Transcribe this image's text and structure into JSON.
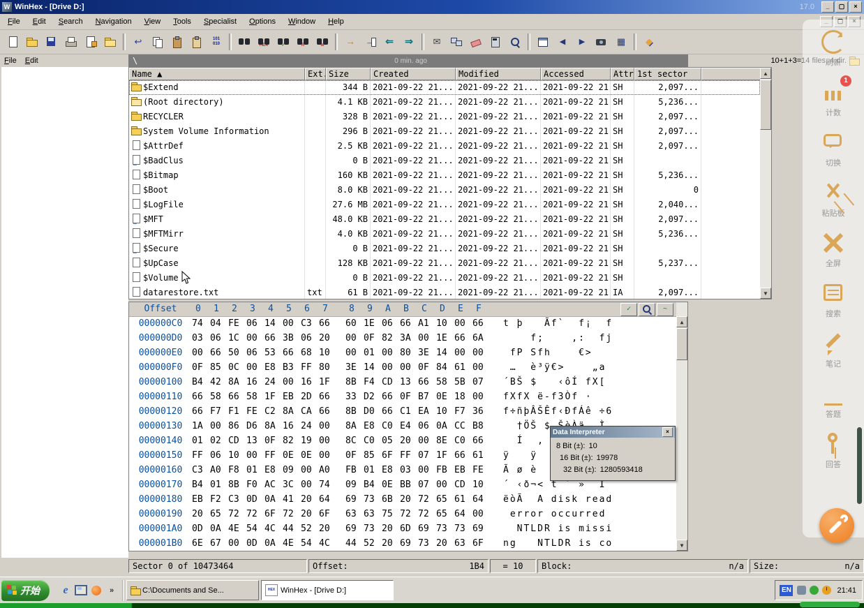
{
  "window": {
    "title": "WinHex - [Drive D:]",
    "version": "17.0",
    "controls": {
      "minimize": "_",
      "maximize": "▢",
      "close": "×"
    }
  },
  "menu": {
    "items": [
      "File",
      "Edit",
      "Search",
      "Navigation",
      "View",
      "Tools",
      "Specialist",
      "Options",
      "Window",
      "Help"
    ]
  },
  "toolbar": {
    "items": [
      {
        "name": "new-file",
        "icon": "page"
      },
      {
        "name": "open-file",
        "icon": "folder"
      },
      {
        "name": "save",
        "icon": "disk"
      },
      {
        "name": "print",
        "icon": "printer"
      },
      {
        "name": "file-properties",
        "icon": "pagepen"
      },
      {
        "name": "open-folder",
        "icon": "folder2"
      },
      {
        "sep": true
      },
      {
        "name": "undo",
        "icon": "undo",
        "glyph": "↩"
      },
      {
        "name": "copy",
        "icon": "copy"
      },
      {
        "name": "clipboard-paste",
        "icon": "clip"
      },
      {
        "name": "clipboard-write",
        "icon": "clip2"
      },
      {
        "name": "convert",
        "icon": "conv",
        "glyph": "101 010"
      },
      {
        "sep": true
      },
      {
        "name": "find-text",
        "icon": "binoc"
      },
      {
        "name": "find-hex",
        "icon": "binochex",
        "glyph": "HEX"
      },
      {
        "name": "find-next",
        "icon": "binoccheck",
        "glyph": "✓"
      },
      {
        "name": "replace",
        "icon": "binocr",
        "glyph": "R"
      },
      {
        "name": "find-again",
        "icon": "binocm",
        "glyph": "M"
      },
      {
        "sep": true
      },
      {
        "name": "goto-offset",
        "icon": "goright",
        "glyph": "→"
      },
      {
        "name": "goto-page",
        "icon": "gopage",
        "glyph": "→"
      },
      {
        "name": "go-back",
        "icon": "backarrow",
        "glyph": "⇐"
      },
      {
        "name": "go-forward",
        "icon": "fwdarrow",
        "glyph": "⇒"
      },
      {
        "sep": true
      },
      {
        "name": "send-mail",
        "icon": "mail",
        "glyph": "✉"
      },
      {
        "name": "network",
        "icon": "net"
      },
      {
        "name": "wipe",
        "icon": "wipe"
      },
      {
        "name": "calculator",
        "icon": "calc"
      },
      {
        "name": "analyze",
        "icon": "mag"
      },
      {
        "sep": true
      },
      {
        "name": "data-interpreter",
        "icon": "interp"
      },
      {
        "name": "previous-window",
        "icon": "prev",
        "glyph": "◀"
      },
      {
        "name": "next-window",
        "icon": "next",
        "glyph": "▶"
      },
      {
        "name": "screenshot",
        "icon": "cam"
      },
      {
        "name": "grid-view",
        "icon": "table",
        "glyph": "▦"
      },
      {
        "sep": true
      },
      {
        "name": "help",
        "icon": "help",
        "glyph": "◆"
      }
    ]
  },
  "left_panel": {
    "items": [
      "File",
      "Edit"
    ]
  },
  "path_bar": {
    "path": "\\",
    "age": "0 min. ago",
    "summary": "10+1+3=14 files, 4 dir."
  },
  "directory": {
    "columns": [
      "Name",
      "Ext.",
      "Size",
      "Created",
      "Modified",
      "Accessed",
      "Attr.",
      "1st sector"
    ],
    "sort_indicator": "▲",
    "rows": [
      {
        "icon": "folder",
        "name": "$Extend",
        "ext": "",
        "size": "344 B",
        "created": "2021-09-22 21...",
        "modified": "2021-09-22 21...",
        "accessed": "2021-09-22 21...",
        "attr": "SH",
        "sector": "2,097..."
      },
      {
        "icon": "folder-root",
        "name": "(Root directory)",
        "ext": "",
        "size": "4.1 KB",
        "created": "2021-09-22 21...",
        "modified": "2021-09-22 21...",
        "accessed": "2021-09-22 21...",
        "attr": "SH",
        "sector": "5,236..."
      },
      {
        "icon": "folder",
        "name": "RECYCLER",
        "ext": "",
        "size": "328 B",
        "created": "2021-09-22 21...",
        "modified": "2021-09-22 21...",
        "accessed": "2021-09-22 21...",
        "attr": "SH",
        "sector": "2,097..."
      },
      {
        "icon": "folder",
        "name": "System Volume Information",
        "ext": "",
        "size": "296 B",
        "created": "2021-09-22 21...",
        "modified": "2021-09-22 21...",
        "accessed": "2021-09-22 21...",
        "attr": "SH",
        "sector": "2,097..."
      },
      {
        "icon": "file",
        "name": "$AttrDef",
        "ext": "",
        "size": "2.5 KB",
        "created": "2021-09-22 21...",
        "modified": "2021-09-22 21...",
        "accessed": "2021-09-22 21...",
        "attr": "SH",
        "sector": "2,097..."
      },
      {
        "icon": "file-dots",
        "name": "$BadClus",
        "ext": "",
        "size": "0 B",
        "created": "2021-09-22 21...",
        "modified": "2021-09-22 21...",
        "accessed": "2021-09-22 21...",
        "attr": "SH",
        "sector": ""
      },
      {
        "icon": "file",
        "name": "$Bitmap",
        "ext": "",
        "size": "160 KB",
        "created": "2021-09-22 21...",
        "modified": "2021-09-22 21...",
        "accessed": "2021-09-22 21...",
        "attr": "SH",
        "sector": "5,236..."
      },
      {
        "icon": "file",
        "name": "$Boot",
        "ext": "",
        "size": "8.0 KB",
        "created": "2021-09-22 21...",
        "modified": "2021-09-22 21...",
        "accessed": "2021-09-22 21...",
        "attr": "SH",
        "sector": "0"
      },
      {
        "icon": "file",
        "name": "$LogFile",
        "ext": "",
        "size": "27.6 MB",
        "created": "2021-09-22 21...",
        "modified": "2021-09-22 21...",
        "accessed": "2021-09-22 21...",
        "attr": "SH",
        "sector": "2,040..."
      },
      {
        "icon": "file-dots",
        "name": "$MFT",
        "ext": "",
        "size": "48.0 KB",
        "created": "2021-09-22 21...",
        "modified": "2021-09-22 21...",
        "accessed": "2021-09-22 21...",
        "attr": "SH",
        "sector": "2,097..."
      },
      {
        "icon": "file",
        "name": "$MFTMirr",
        "ext": "",
        "size": "4.0 KB",
        "created": "2021-09-22 21...",
        "modified": "2021-09-22 21...",
        "accessed": "2021-09-22 21...",
        "attr": "SH",
        "sector": "5,236..."
      },
      {
        "icon": "file-dots",
        "name": "$Secure",
        "ext": "",
        "size": "0 B",
        "created": "2021-09-22 21...",
        "modified": "2021-09-22 21...",
        "accessed": "2021-09-22 21...",
        "attr": "SH",
        "sector": ""
      },
      {
        "icon": "file",
        "name": "$UpCase",
        "ext": "",
        "size": "128 KB",
        "created": "2021-09-22 21...",
        "modified": "2021-09-22 21...",
        "accessed": "2021-09-22 21...",
        "attr": "SH",
        "sector": "5,237..."
      },
      {
        "icon": "file",
        "name": "$Volume",
        "ext": "",
        "size": "0 B",
        "created": "2021-09-22 21...",
        "modified": "2021-09-22 21...",
        "accessed": "2021-09-22 21...",
        "attr": "SH",
        "sector": ""
      },
      {
        "icon": "file",
        "name": "datarestore.txt",
        "ext": "txt",
        "size": "61 B",
        "created": "2021-09-22 21...",
        "modified": "2021-09-22 21...",
        "accessed": "2021-09-22 21...",
        "attr": "IA",
        "sector": "2,097..."
      }
    ]
  },
  "hex": {
    "offset_header": "Offset",
    "col_headers": [
      "0",
      "1",
      "2",
      "3",
      "4",
      "5",
      "6",
      "7",
      "8",
      "9",
      "A",
      "B",
      "C",
      "D",
      "E",
      "F"
    ],
    "tools": [
      "bookmark-dropdown",
      "search-page",
      "wave"
    ],
    "rows": [
      {
        "offset": "000000C0",
        "bytes": [
          "74",
          "04",
          "FE",
          "06",
          "14",
          "00",
          "C3",
          "66",
          "60",
          "1E",
          "06",
          "66",
          "A1",
          "10",
          "00",
          "66"
        ],
        "ansi": "t þ   Ãf`  f¡  f"
      },
      {
        "offset": "000000D0",
        "bytes": [
          "03",
          "06",
          "1C",
          "00",
          "66",
          "3B",
          "06",
          "20",
          "00",
          "0F",
          "82",
          "3A",
          "00",
          "1E",
          "66",
          "6A"
        ],
        "ansi": "    f;    ‚:  fj"
      },
      {
        "offset": "000000E0",
        "bytes": [
          "00",
          "66",
          "50",
          "06",
          "53",
          "66",
          "68",
          "10",
          "00",
          "01",
          "00",
          "80",
          "3E",
          "14",
          "00",
          "00"
        ],
        "ansi": " fP Sfh    €>   "
      },
      {
        "offset": "000000F0",
        "bytes": [
          "0F",
          "85",
          "0C",
          "00",
          "E8",
          "B3",
          "FF",
          "80",
          "3E",
          "14",
          "00",
          "00",
          "0F",
          "84",
          "61",
          "00"
        ],
        "ansi": " …  è³ÿ€>    „a "
      },
      {
        "offset": "00000100",
        "bytes": [
          "B4",
          "42",
          "8A",
          "16",
          "24",
          "00",
          "16",
          "1F",
          "8B",
          "F4",
          "CD",
          "13",
          "66",
          "58",
          "5B",
          "07"
        ],
        "ansi": "´BŠ $   ‹ôÍ fX[ "
      },
      {
        "offset": "00000110",
        "bytes": [
          "66",
          "58",
          "66",
          "58",
          "1F",
          "EB",
          "2D",
          "66",
          "33",
          "D2",
          "66",
          "0F",
          "B7",
          "0E",
          "18",
          "00"
        ],
        "ansi": "fXfX ë-f3Òf ·   "
      },
      {
        "offset": "00000120",
        "bytes": [
          "66",
          "F7",
          "F1",
          "FE",
          "C2",
          "8A",
          "CA",
          "66",
          "8B",
          "D0",
          "66",
          "C1",
          "EA",
          "10",
          "F7",
          "36"
        ],
        "ansi": "f÷ñþÂŠÊf‹ÐfÁê ÷6"
      },
      {
        "offset": "00000130",
        "bytes": [
          "1A",
          "00",
          "86",
          "D6",
          "8A",
          "16",
          "24",
          "00",
          "8A",
          "E8",
          "C0",
          "E4",
          "06",
          "0A",
          "CC",
          "B8"
        ],
        "ansi": "  †ÖŠ $ ŠèÀä  Ì¸"
      },
      {
        "offset": "00000140",
        "bytes": [
          "01",
          "02",
          "CD",
          "13",
          "0F",
          "82",
          "19",
          "00",
          "8C",
          "C0",
          "05",
          "20",
          "00",
          "8E",
          "C0",
          "66"
        ],
        "ansi": "  Í  ‚  ŒÀ   ŽÀf"
      },
      {
        "offset": "00000150",
        "bytes": [
          "FF",
          "06",
          "10",
          "00",
          "FF",
          "0E",
          "0E",
          "00",
          "0F",
          "85",
          "6F",
          "FF",
          "07",
          "1F",
          "66",
          "61"
        ],
        "ansi": "ÿ   ÿ    …oÿ  fa"
      },
      {
        "offset": "00000160",
        "bytes": [
          "C3",
          "A0",
          "F8",
          "01",
          "E8",
          "09",
          "00",
          "A0",
          "FB",
          "01",
          "E8",
          "03",
          "00",
          "FB",
          "EB",
          "FE"
        ],
        "ansi": "Ã ø è   û è  ûëþ"
      },
      {
        "offset": "00000170",
        "bytes": [
          "B4",
          "01",
          "8B",
          "F0",
          "AC",
          "3C",
          "00",
          "74",
          "09",
          "B4",
          "0E",
          "BB",
          "07",
          "00",
          "CD",
          "10"
        ],
        "ansi": "´ ‹ð¬< t ´ »  Í "
      },
      {
        "offset": "00000180",
        "bytes": [
          "EB",
          "F2",
          "C3",
          "0D",
          "0A",
          "41",
          "20",
          "64",
          "69",
          "73",
          "6B",
          "20",
          "72",
          "65",
          "61",
          "64"
        ],
        "ansi": "ëòÃ  A disk read"
      },
      {
        "offset": "00000190",
        "bytes": [
          "20",
          "65",
          "72",
          "72",
          "6F",
          "72",
          "20",
          "6F",
          "63",
          "63",
          "75",
          "72",
          "72",
          "65",
          "64",
          "00"
        ],
        "ansi": " error occurred "
      },
      {
        "offset": "000001A0",
        "bytes": [
          "0D",
          "0A",
          "4E",
          "54",
          "4C",
          "44",
          "52",
          "20",
          "69",
          "73",
          "20",
          "6D",
          "69",
          "73",
          "73",
          "69"
        ],
        "ansi": "  NTLDR is missi"
      },
      {
        "offset": "000001B0",
        "bytes": [
          "6E",
          "67",
          "00",
          "0D",
          "0A",
          "4E",
          "54",
          "4C",
          "44",
          "52",
          "20",
          "69",
          "73",
          "20",
          "63",
          "6F"
        ],
        "ansi": "ng   NTLDR is co"
      }
    ]
  },
  "interpreter": {
    "title": "Data Interpreter",
    "rows": [
      {
        "label": "8 Bit (±):",
        "value": "10"
      },
      {
        "label": "16 Bit (±):",
        "value": "19978"
      },
      {
        "label": "32 Bit (±):",
        "value": "1280593418"
      }
    ]
  },
  "status": {
    "sector": "Sector 0 of 10473464",
    "offset_label": "Offset:",
    "offset_value": "1B4",
    "byte_value": "= 10",
    "block_label": "Block:",
    "block_value": "n/a",
    "size_label": "Size:",
    "size_value": "n/a"
  },
  "taskbar": {
    "start_label": "开始",
    "quick_launch": [
      {
        "name": "internet-explorer",
        "cls": "ql-ie",
        "glyph": "e"
      },
      {
        "name": "show-desktop",
        "cls": "ql-desktop",
        "glyph": ""
      },
      {
        "name": "media-player",
        "cls": "ql-media",
        "glyph": ""
      },
      {
        "name": "quick-launch-more",
        "cls": "ql-more",
        "glyph": "»"
      }
    ],
    "tasks": [
      {
        "label": "C:\\Documents and Se...",
        "icon": "folder",
        "active": false
      },
      {
        "label": "WinHex - [Drive D:]",
        "icon": "winhex",
        "active": true
      }
    ],
    "tray": {
      "lang": "EN",
      "icons": [
        "volume",
        "shield",
        "clock"
      ],
      "time": "21:41"
    }
  },
  "sidebar": {
    "items": [
      {
        "name": "refresh",
        "icon": "refresh",
        "label": "刷新"
      },
      {
        "name": "stats",
        "icon": "bars",
        "label": "计数",
        "badge": "1"
      },
      {
        "name": "switch",
        "icon": "chat",
        "label": "切换"
      },
      {
        "name": "clipboard",
        "icon": "cut",
        "label": "粘贴板"
      },
      {
        "name": "fullscreen",
        "icon": "full",
        "label": "全屏"
      },
      {
        "name": "search",
        "icon": "book",
        "label": "搜索"
      },
      {
        "name": "notes",
        "icon": "pen",
        "label": "笔记"
      },
      {
        "name": "answer",
        "icon": "answer",
        "label": "答题"
      },
      {
        "name": "reply",
        "icon": "key",
        "label": "回答"
      }
    ]
  }
}
